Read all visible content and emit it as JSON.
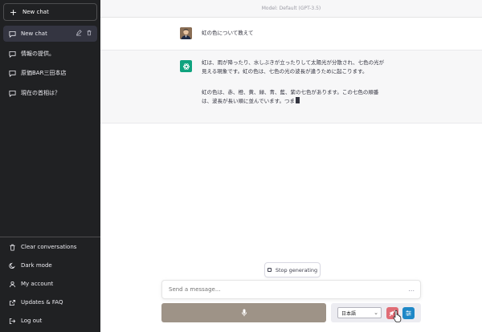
{
  "sidebar": {
    "new_chat": "New chat",
    "conversations": [
      {
        "label": "New chat",
        "active": true
      },
      {
        "label": "情報の提供。"
      },
      {
        "label": "原価BAR三田本店"
      },
      {
        "label": "現在の首相は？"
      }
    ],
    "bottom": [
      {
        "label": "Clear conversations",
        "icon": "trash-icon"
      },
      {
        "label": "Dark mode",
        "icon": "moon-icon"
      },
      {
        "label": "My account",
        "icon": "user-icon"
      },
      {
        "label": "Updates & FAQ",
        "icon": "external-link-icon"
      },
      {
        "label": "Log out",
        "icon": "logout-icon"
      }
    ]
  },
  "main": {
    "model_label": "Model: Default (GPT-3.5)",
    "user_message": "虹の色について教えて",
    "assistant_p1": "虹は、雨が降ったり、水しぶきが立ったりして太陽光が分散され、七色の光が見える現象です。虹の色は、七色の光の波長が違うために起こります。",
    "assistant_p2": "虹の色は、赤、橙、黄、緑、青、藍、紫の七色があります。この七色の順番は、波長が長い順に並んでいます。つま",
    "stop_label": "Stop generating",
    "input_placeholder": "Send a message...",
    "more_label": "...",
    "language": "日本語"
  },
  "colors": {
    "sidebar_bg": "#202123",
    "assistant_bg": "#f7f7f8",
    "accent_green": "#10a37f",
    "mic_bar": "#9e9387",
    "mute_button": "#e06c75",
    "settings_button": "#1e88c7"
  }
}
